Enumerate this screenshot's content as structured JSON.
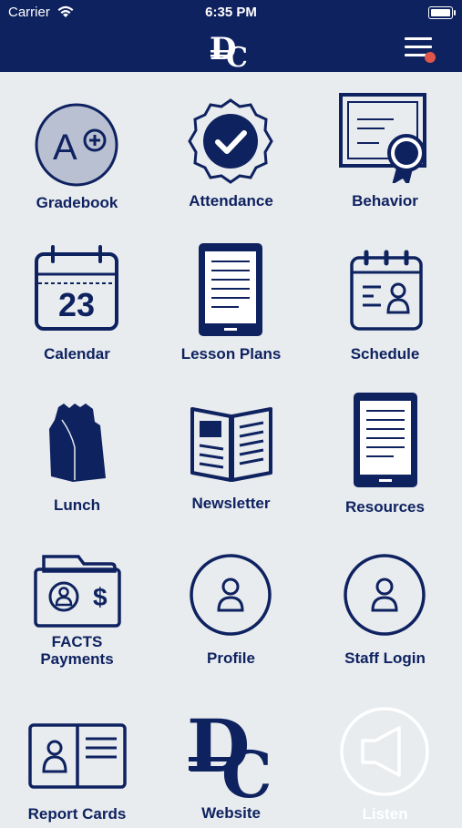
{
  "status_bar": {
    "carrier": "Carrier",
    "time": "6:35 PM"
  },
  "header": {
    "logo_text": "DC"
  },
  "tiles": [
    {
      "label": "Gradebook",
      "icon": "gradebook-icon"
    },
    {
      "label": "Attendance",
      "icon": "attendance-icon"
    },
    {
      "label": "Behavior",
      "icon": "behavior-icon"
    },
    {
      "label": "Calendar",
      "icon": "calendar-icon",
      "icon_text": "23"
    },
    {
      "label": "Lesson Plans",
      "icon": "tablet-icon"
    },
    {
      "label": "Schedule",
      "icon": "schedule-icon"
    },
    {
      "label": "Lunch",
      "icon": "lunch-bag-icon"
    },
    {
      "label": "Newsletter",
      "icon": "newsletter-icon"
    },
    {
      "label": "Resources",
      "icon": "tablet-icon"
    },
    {
      "label": "FACTS\nPayments",
      "icon": "facts-payments-icon"
    },
    {
      "label": "Profile",
      "icon": "profile-icon"
    },
    {
      "label": "Staff Login",
      "icon": "staff-login-icon"
    },
    {
      "label": "Report Cards",
      "icon": "report-cards-icon"
    },
    {
      "label": "Website",
      "icon": "dc-logo-icon",
      "icon_text": "DC"
    },
    {
      "label": "Listen",
      "icon": "speaker-icon"
    }
  ],
  "colors": {
    "navy": "#0f2260",
    "background": "#e8ecef",
    "notification_dot": "#e0554a",
    "gradebook_fill": "#b9c0d2"
  }
}
